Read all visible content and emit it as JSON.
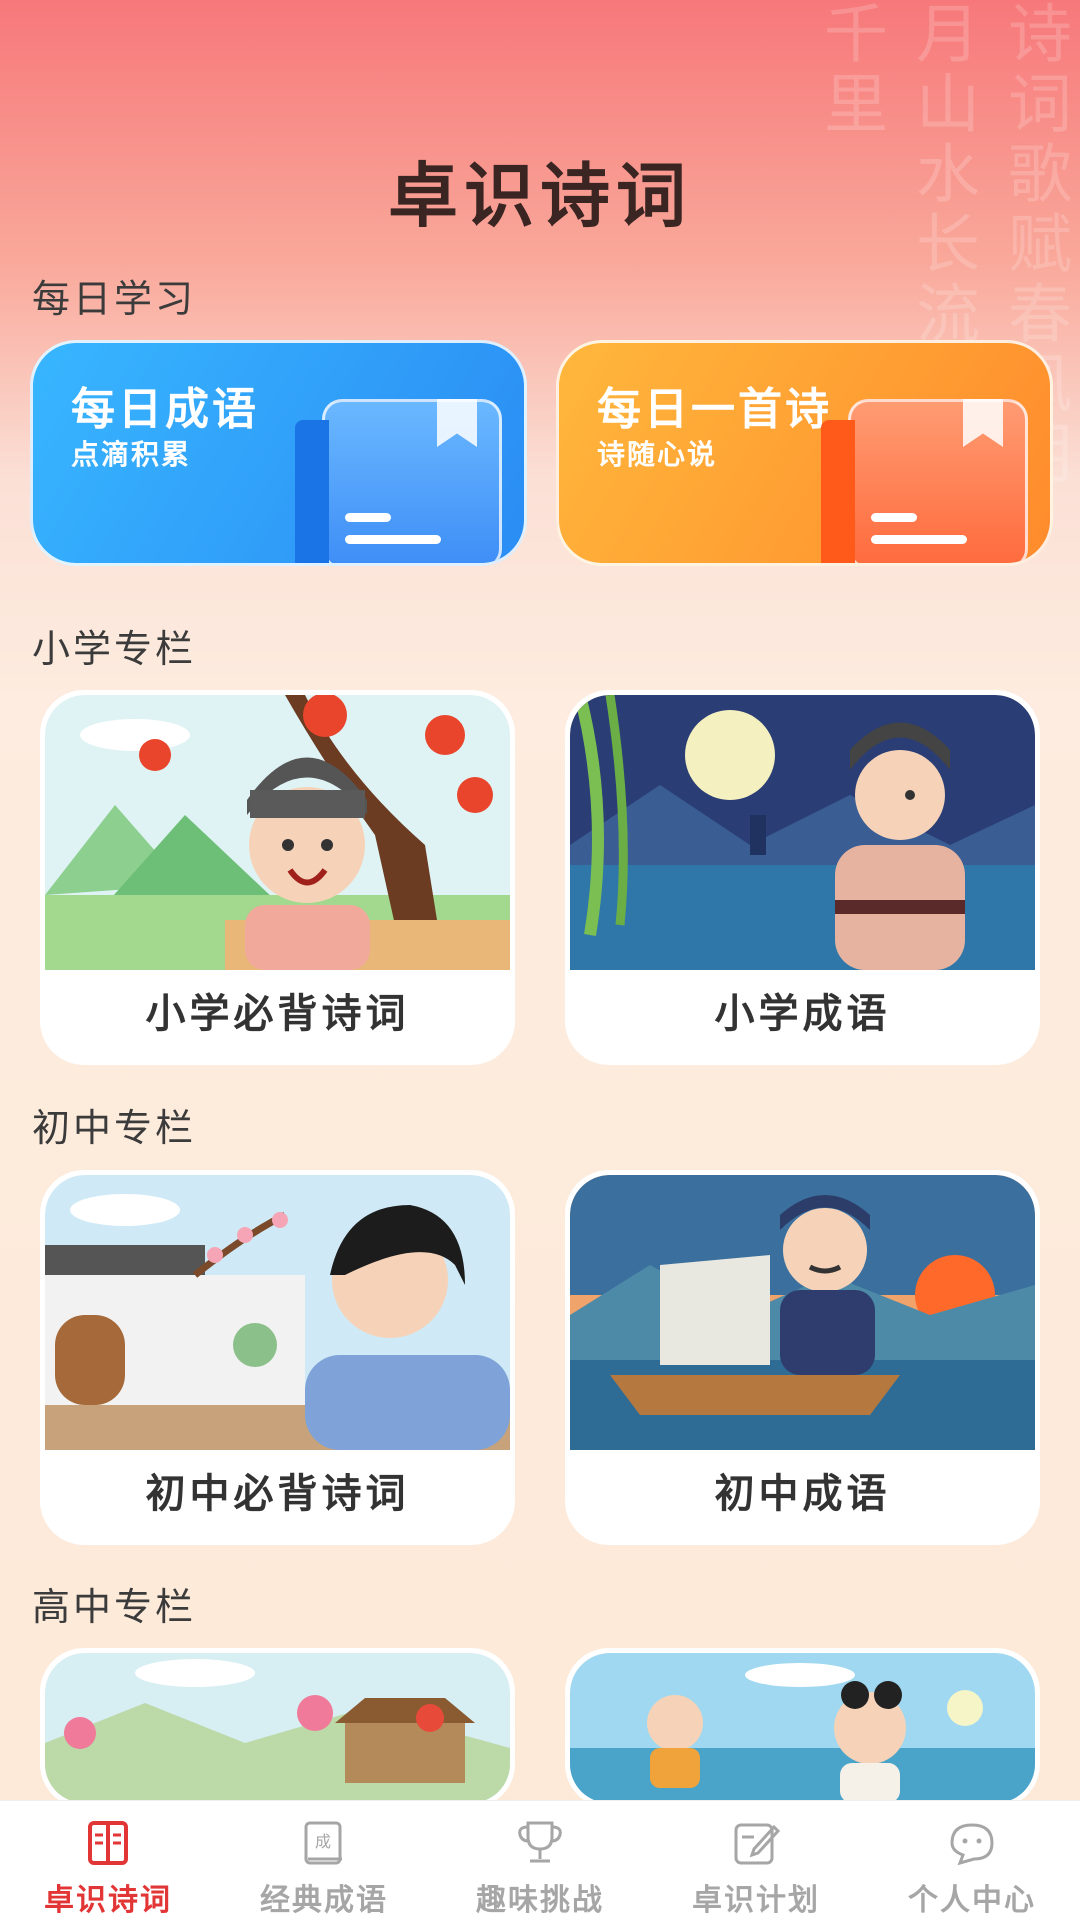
{
  "header": {
    "title": "卓识诗词"
  },
  "sections": {
    "daily": {
      "title": "每日学习",
      "cards": [
        {
          "title": "每日成语",
          "subtitle": "点滴积累"
        },
        {
          "title": "每日一首诗",
          "subtitle": "诗随心说"
        }
      ]
    },
    "primary": {
      "title": "小学专栏",
      "cards": [
        {
          "label": "小学必背诗词"
        },
        {
          "label": "小学成语"
        }
      ]
    },
    "middle": {
      "title": "初中专栏",
      "cards": [
        {
          "label": "初中必背诗词"
        },
        {
          "label": "初中成语"
        }
      ]
    },
    "high": {
      "title": "高中专栏"
    }
  },
  "tabbar": {
    "items": [
      {
        "label": "卓识诗词",
        "icon": "book-icon",
        "active": true
      },
      {
        "label": "经典成语",
        "icon": "idiom-icon",
        "active": false
      },
      {
        "label": "趣味挑战",
        "icon": "trophy-icon",
        "active": false
      },
      {
        "label": "卓识计划",
        "icon": "plan-icon",
        "active": false
      },
      {
        "label": "个人中心",
        "icon": "profile-icon",
        "active": false
      }
    ]
  },
  "colors": {
    "accent": "#e23535",
    "blue_card": "#2a8cf3",
    "orange_card": "#ff8b2c"
  }
}
